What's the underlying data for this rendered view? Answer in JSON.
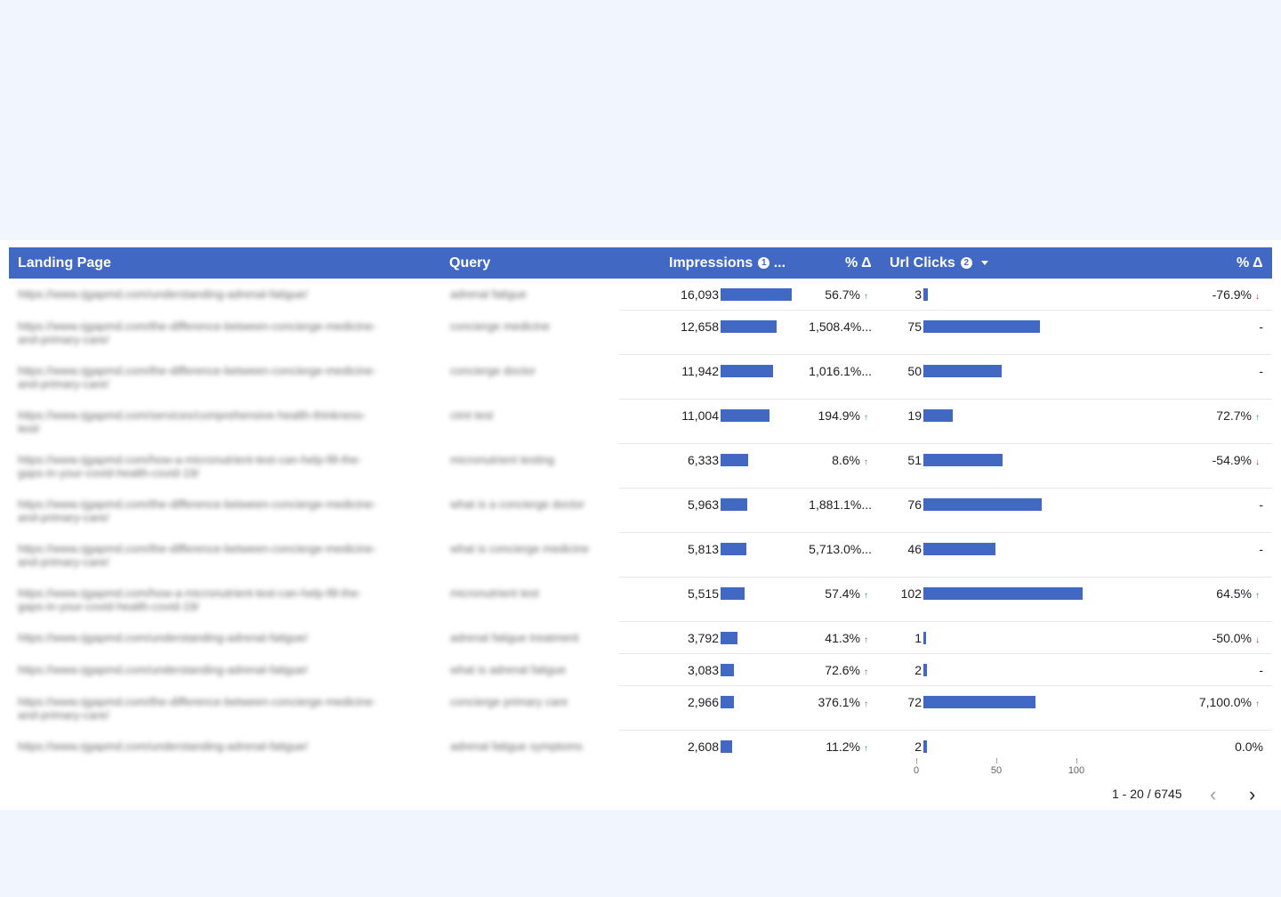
{
  "colors": {
    "accent": "#4169c3",
    "up": "#2e9a43",
    "down": "#d93025",
    "page_bg": "#f1f5fd"
  },
  "table": {
    "headers": {
      "landing_page": "Landing Page",
      "query": "Query",
      "impressions": "Impressions",
      "impressions_info": "1",
      "impressions_more": "...",
      "pct_delta_1": "% Δ",
      "url_clicks": "Url Clicks",
      "url_clicks_info": "2",
      "pct_delta_2": "% Δ"
    },
    "rows": [
      {
        "landing": "https://www.rjgapmd.com/understanding-adrenal-fatigue/",
        "landing2": "",
        "query": "adrenal fatigue",
        "impressions": 16093,
        "impressions_label": "16,093",
        "imp_pct": "56.7%",
        "imp_dir": "up",
        "clicks": 3,
        "clicks_label": "3",
        "click_pct": "-76.9%",
        "click_dir": "down"
      },
      {
        "landing": "https://www.rjgapmd.com/the-difference-between-concierge-medicine-",
        "landing2": "and-primary-care/",
        "query": "concierge medicine",
        "impressions": 12658,
        "impressions_label": "12,658",
        "imp_pct": "1,508.4%...",
        "imp_dir": "",
        "clicks": 75,
        "clicks_label": "75",
        "click_pct": "-",
        "click_dir": ""
      },
      {
        "landing": "https://www.rjgapmd.com/the-difference-between-concierge-medicine-",
        "landing2": "and-primary-care/",
        "query": "concierge doctor",
        "impressions": 11942,
        "impressions_label": "11,942",
        "imp_pct": "1,016.1%...",
        "imp_dir": "",
        "clicks": 50,
        "clicks_label": "50",
        "click_pct": "-",
        "click_dir": ""
      },
      {
        "landing": "https://www.rjgapmd.com/services/comprehensive-health-thinkness-",
        "landing2": "test/",
        "query": "cimt test",
        "impressions": 11004,
        "impressions_label": "11,004",
        "imp_pct": "194.9%",
        "imp_dir": "up",
        "clicks": 19,
        "clicks_label": "19",
        "click_pct": "72.7%",
        "click_dir": "up"
      },
      {
        "landing": "https://www.rjgapmd.com/how-a-micronutrient-test-can-help-fill-the-",
        "landing2": "gaps-in-your-covid-health-covid-19/",
        "query": "micronutrient testing",
        "impressions": 6333,
        "impressions_label": "6,333",
        "imp_pct": "8.6%",
        "imp_dir": "up",
        "clicks": 51,
        "clicks_label": "51",
        "click_pct": "-54.9%",
        "click_dir": "down"
      },
      {
        "landing": "https://www.rjgapmd.com/the-difference-between-concierge-medicine-",
        "landing2": "and-primary-care/",
        "query": "what is a concierge doctor",
        "impressions": 5963,
        "impressions_label": "5,963",
        "imp_pct": "1,881.1%...",
        "imp_dir": "",
        "clicks": 76,
        "clicks_label": "76",
        "click_pct": "-",
        "click_dir": ""
      },
      {
        "landing": "https://www.rjgapmd.com/the-difference-between-concierge-medicine-",
        "landing2": "and-primary-care/",
        "query": "what is concierge medicine",
        "impressions": 5813,
        "impressions_label": "5,813",
        "imp_pct": "5,713.0%...",
        "imp_dir": "",
        "clicks": 46,
        "clicks_label": "46",
        "click_pct": "-",
        "click_dir": ""
      },
      {
        "landing": "https://www.rjgapmd.com/how-a-micronutrient-test-can-help-fill-the-",
        "landing2": "gaps-in-your-covid-health-covid-19/",
        "query": "micronutrient test",
        "impressions": 5515,
        "impressions_label": "5,515",
        "imp_pct": "57.4%",
        "imp_dir": "up",
        "clicks": 102,
        "clicks_label": "102",
        "click_pct": "64.5%",
        "click_dir": "up"
      },
      {
        "landing": "https://www.rjgapmd.com/understanding-adrenal-fatigue/",
        "landing2": "",
        "query": "adrenal fatigue treatment",
        "impressions": 3792,
        "impressions_label": "3,792",
        "imp_pct": "41.3%",
        "imp_dir": "up",
        "clicks": 1,
        "clicks_label": "1",
        "click_pct": "-50.0%",
        "click_dir": "down"
      },
      {
        "landing": "https://www.rjgapmd.com/understanding-adrenal-fatigue/",
        "landing2": "",
        "query": "what is adrenal fatigue",
        "impressions": 3083,
        "impressions_label": "3,083",
        "imp_pct": "72.6%",
        "imp_dir": "up",
        "clicks": 2,
        "clicks_label": "2",
        "click_pct": "-",
        "click_dir": ""
      },
      {
        "landing": "https://www.rjgapmd.com/the-difference-between-concierge-medicine-",
        "landing2": "and-primary-care/",
        "query": "concierge primary care",
        "impressions": 2966,
        "impressions_label": "2,966",
        "imp_pct": "376.1%",
        "imp_dir": "up",
        "clicks": 72,
        "clicks_label": "72",
        "click_pct": "7,100.0%",
        "click_dir": "up"
      },
      {
        "landing": "https://www.rjgapmd.com/understanding-adrenal-fatigue/",
        "landing2": "",
        "query": "adrenal fatigue symptoms",
        "impressions": 2608,
        "impressions_label": "2,608",
        "imp_pct": "11.2%",
        "imp_dir": "up",
        "clicks": 2,
        "clicks_label": "2",
        "click_pct": "0.0%",
        "click_dir": ""
      }
    ],
    "impressions_max": 16093,
    "clicks_axis": {
      "max": 100,
      "ticks": [
        "0",
        "50",
        "100"
      ]
    },
    "pagination": {
      "label": "1 - 20 / 6745",
      "prev": "‹",
      "next": "›"
    }
  }
}
